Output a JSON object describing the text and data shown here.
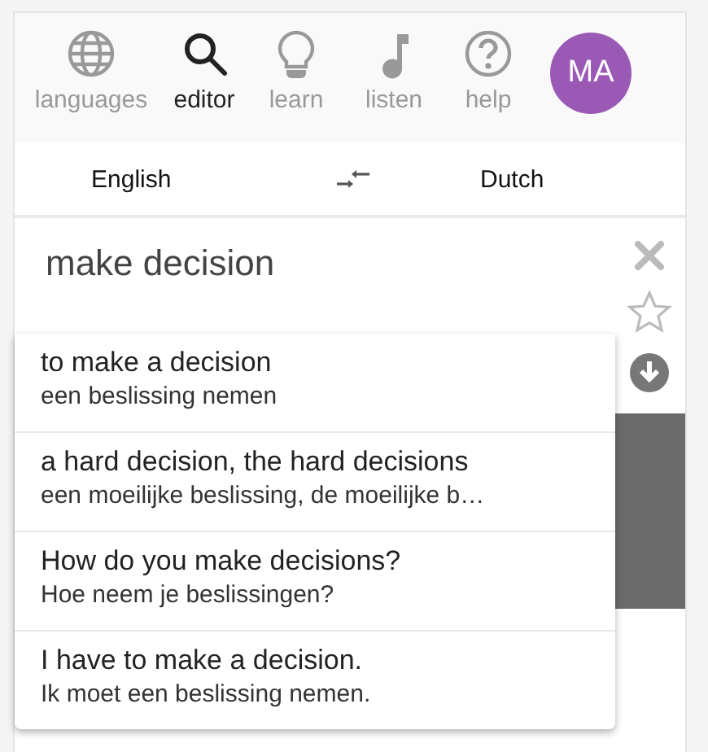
{
  "nav": {
    "items": [
      {
        "label": "languages",
        "kind": "globe",
        "selected": false
      },
      {
        "label": "editor",
        "kind": "search",
        "selected": true
      },
      {
        "label": "learn",
        "kind": "bulb",
        "selected": false
      },
      {
        "label": "listen",
        "kind": "note",
        "selected": false
      },
      {
        "label": "help",
        "kind": "help",
        "selected": false
      }
    ],
    "avatar": {
      "initials": "MA",
      "color": "#9b59b6"
    }
  },
  "languages": {
    "source": "English",
    "target": "Dutch"
  },
  "editor": {
    "value": "make decision"
  },
  "suggestions": [
    {
      "phrase": "to make a decision",
      "translation": "een beslissing nemen"
    },
    {
      "phrase": "a hard decision, the hard decisions",
      "translation": "een moeilijke beslissing, de moeilijke b…"
    },
    {
      "phrase": "How do you make decisions?",
      "translation": "Hoe neem je beslissingen?"
    },
    {
      "phrase": "I have to make a decision.",
      "translation": "Ik moet een beslissing nemen."
    }
  ]
}
